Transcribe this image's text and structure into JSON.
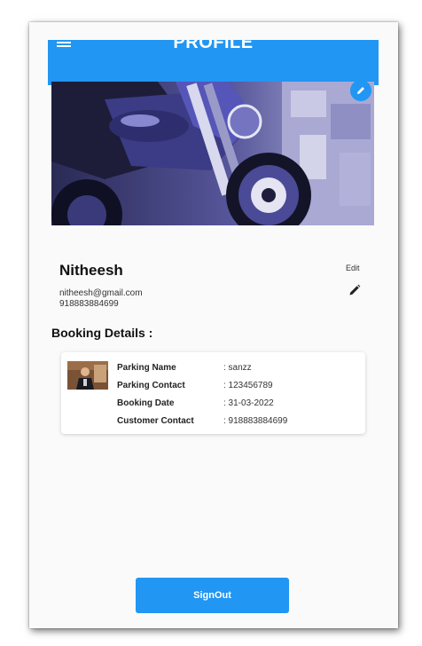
{
  "app_bar": {
    "title": "PROFILE",
    "menu_icon": "menu-icon"
  },
  "profile": {
    "name": "Nitheesh",
    "email": "nitheesh@gmail.com",
    "phone": "918883884699",
    "edit_label": "Edit",
    "edit_icon": "pencil-icon",
    "cover_edit_icon": "pencil-icon"
  },
  "booking": {
    "section_title": "Booking Details :",
    "rows": [
      {
        "label": "Parking Name",
        "value": ": sanzz"
      },
      {
        "label": "Parking Contact",
        "value": ": 123456789"
      },
      {
        "label": "Booking Date",
        "value": ": 31-03-2022"
      },
      {
        "label": "Customer Contact",
        "value": ": 918883884699"
      }
    ]
  },
  "signout_label": "SignOut",
  "colors": {
    "primary": "#2196f3",
    "background": "#fafafa",
    "text": "#111111"
  }
}
